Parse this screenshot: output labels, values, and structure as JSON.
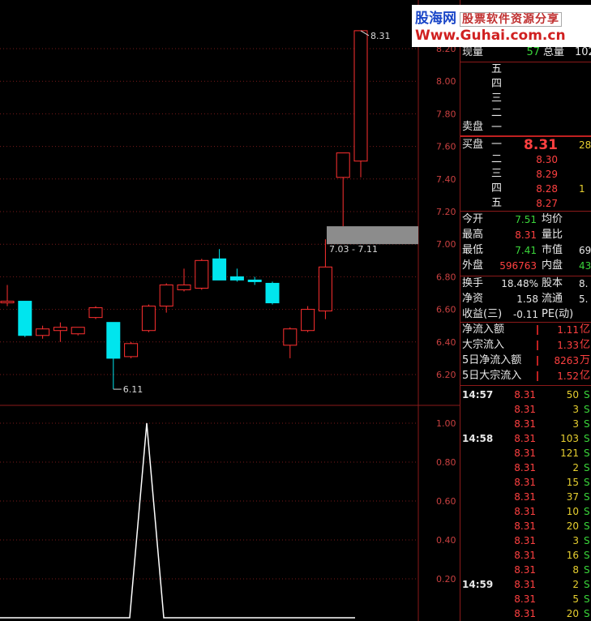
{
  "logo": {
    "site_name": "股海网",
    "tagline": "股票软件资源分享",
    "url": "Www.Guhai.com.cn"
  },
  "price_axis": [
    {
      "label": "8.20",
      "v": 8.2
    },
    {
      "label": "8.00",
      "v": 8.0
    },
    {
      "label": "7.80",
      "v": 7.8
    },
    {
      "label": "7.60",
      "v": 7.6
    },
    {
      "label": "7.40",
      "v": 7.4
    },
    {
      "label": "7.20",
      "v": 7.2
    },
    {
      "label": "7.00",
      "v": 7.0
    },
    {
      "label": "6.80",
      "v": 6.8
    },
    {
      "label": "6.60",
      "v": 6.6
    },
    {
      "label": "6.40",
      "v": 6.4
    },
    {
      "label": "6.20",
      "v": 6.2
    }
  ],
  "indicator_axis": [
    {
      "label": "1.00",
      "v": 1.0
    },
    {
      "label": "0.80",
      "v": 0.8
    },
    {
      "label": "0.60",
      "v": 0.6
    },
    {
      "label": "0.40",
      "v": 0.4
    },
    {
      "label": "0.20",
      "v": 0.2
    }
  ],
  "chart_data": {
    "type": "candlestick",
    "candles": [
      {
        "o": 6.65,
        "c": 6.65,
        "h": 6.75,
        "l": 6.62
      },
      {
        "o": 6.65,
        "c": 6.44,
        "h": 6.65,
        "l": 6.43
      },
      {
        "o": 6.44,
        "c": 6.48,
        "h": 6.5,
        "l": 6.42
      },
      {
        "o": 6.47,
        "c": 6.49,
        "h": 6.52,
        "l": 6.4
      },
      {
        "o": 6.45,
        "c": 6.49,
        "h": 6.49,
        "l": 6.44
      },
      {
        "o": 6.55,
        "c": 6.61,
        "h": 6.62,
        "l": 6.54
      },
      {
        "o": 6.52,
        "c": 6.3,
        "h": 6.52,
        "l": 6.11
      },
      {
        "o": 6.31,
        "c": 6.39,
        "h": 6.4,
        "l": 6.3
      },
      {
        "o": 6.47,
        "c": 6.62,
        "h": 6.63,
        "l": 6.46
      },
      {
        "o": 6.62,
        "c": 6.75,
        "h": 6.76,
        "l": 6.58
      },
      {
        "o": 6.72,
        "c": 6.75,
        "h": 6.85,
        "l": 6.71
      },
      {
        "o": 6.73,
        "c": 6.9,
        "h": 6.91,
        "l": 6.72
      },
      {
        "o": 6.91,
        "c": 6.78,
        "h": 6.97,
        "l": 6.78
      },
      {
        "o": 6.8,
        "c": 6.78,
        "h": 6.85,
        "l": 6.77
      },
      {
        "o": 6.78,
        "c": 6.77,
        "h": 6.8,
        "l": 6.75
      },
      {
        "o": 6.76,
        "c": 6.64,
        "h": 6.77,
        "l": 6.63
      },
      {
        "o": 6.38,
        "c": 6.48,
        "h": 6.49,
        "l": 6.3
      },
      {
        "o": 6.47,
        "c": 6.6,
        "h": 6.62,
        "l": 6.46
      },
      {
        "o": 6.59,
        "c": 6.86,
        "h": 7.03,
        "l": 6.54
      },
      {
        "o": 7.41,
        "c": 7.56,
        "h": 7.56,
        "l": 7.11
      },
      {
        "o": 7.51,
        "c": 8.31,
        "h": 8.31,
        "l": 7.41
      }
    ],
    "annotations": {
      "high_label": "8.31",
      "low_label": "6.11",
      "gap_label": "7.03 - 7.11",
      "gap_low": 7.03,
      "gap_high": 7.11
    },
    "indicator": {
      "values": [
        0,
        0,
        0,
        0,
        0,
        0,
        0,
        0,
        1,
        0,
        0,
        0,
        0,
        0,
        0,
        0,
        0,
        0,
        0,
        0,
        0
      ]
    }
  },
  "quote": {
    "xianliang_label": "现量",
    "xianliang_value": "57",
    "zongliang_label": "总量",
    "zongliang_value": "102",
    "sell_label": "卖盘",
    "buy_label": "买盘",
    "sell_levels": [
      {
        "level": "五",
        "price": "",
        "vol": ""
      },
      {
        "level": "四",
        "price": "",
        "vol": ""
      },
      {
        "level": "三",
        "price": "",
        "vol": ""
      },
      {
        "level": "二",
        "price": "",
        "vol": ""
      },
      {
        "level": "一",
        "price": "",
        "vol": ""
      }
    ],
    "buy_levels": [
      {
        "level": "一",
        "price": "8.31",
        "vol": "28"
      },
      {
        "level": "二",
        "price": "8.30",
        "vol": ""
      },
      {
        "level": "三",
        "price": "8.29",
        "vol": ""
      },
      {
        "level": "四",
        "price": "8.28",
        "vol": "1"
      },
      {
        "level": "五",
        "price": "8.27",
        "vol": ""
      }
    ],
    "stats": [
      {
        "l1": "今开",
        "v1": "7.51",
        "c1": "green",
        "l2": "均价",
        "v2": ""
      },
      {
        "l1": "最高",
        "v1": "8.31",
        "c1": "red",
        "l2": "量比",
        "v2": ""
      },
      {
        "l1": "最低",
        "v1": "7.41",
        "c1": "green",
        "l2": "市值",
        "v2": "69"
      },
      {
        "l1": "外盘",
        "v1": "596763",
        "c1": "red",
        "l2": "内盘",
        "v2": "43"
      }
    ],
    "stats2": [
      {
        "l1": "换手",
        "v1": "18.48%",
        "l2": "股本",
        "v2": "8."
      },
      {
        "l1": "净资",
        "v1": "1.58",
        "l2": "流通",
        "v2": "5."
      },
      {
        "l1": "收益(三)",
        "v1": "-0.11",
        "l2": "PE(动)",
        "v2": ""
      }
    ],
    "flows": [
      {
        "label": "净流入额",
        "value": "1.11",
        "unit": "亿"
      },
      {
        "label": "大宗流入",
        "value": "1.33",
        "unit": "亿"
      },
      {
        "label": "5日净流入额",
        "value": "8263",
        "unit": "万"
      },
      {
        "label": "5日大宗流入",
        "value": "1.52",
        "unit": "亿"
      }
    ]
  },
  "ticks": [
    {
      "time": "14:57",
      "price": "8.31",
      "vol": "50",
      "flag": "S"
    },
    {
      "time": "",
      "price": "8.31",
      "vol": "3",
      "flag": "S"
    },
    {
      "time": "",
      "price": "8.31",
      "vol": "3",
      "flag": "S"
    },
    {
      "time": "14:58",
      "price": "8.31",
      "vol": "103",
      "flag": "S"
    },
    {
      "time": "",
      "price": "8.31",
      "vol": "121",
      "flag": "S"
    },
    {
      "time": "",
      "price": "8.31",
      "vol": "2",
      "flag": "S"
    },
    {
      "time": "",
      "price": "8.31",
      "vol": "15",
      "flag": "S"
    },
    {
      "time": "",
      "price": "8.31",
      "vol": "37",
      "flag": "S"
    },
    {
      "time": "",
      "price": "8.31",
      "vol": "10",
      "flag": "S"
    },
    {
      "time": "",
      "price": "8.31",
      "vol": "20",
      "flag": "S"
    },
    {
      "time": "",
      "price": "8.31",
      "vol": "3",
      "flag": "S"
    },
    {
      "time": "",
      "price": "8.31",
      "vol": "16",
      "flag": "S"
    },
    {
      "time": "",
      "price": "8.31",
      "vol": "8",
      "flag": "S"
    },
    {
      "time": "14:59",
      "price": "8.31",
      "vol": "2",
      "flag": "S"
    },
    {
      "time": "",
      "price": "8.31",
      "vol": "5",
      "flag": "S"
    },
    {
      "time": "",
      "price": "8.31",
      "vol": "20",
      "flag": "S"
    }
  ],
  "colors": {
    "up": "#ff3030",
    "down": "#00e5ee",
    "grid": "#7a1a1a",
    "axis_text": "#c84040",
    "gap_band": "#8c8c8c",
    "indicator_line": "#ffffff"
  }
}
